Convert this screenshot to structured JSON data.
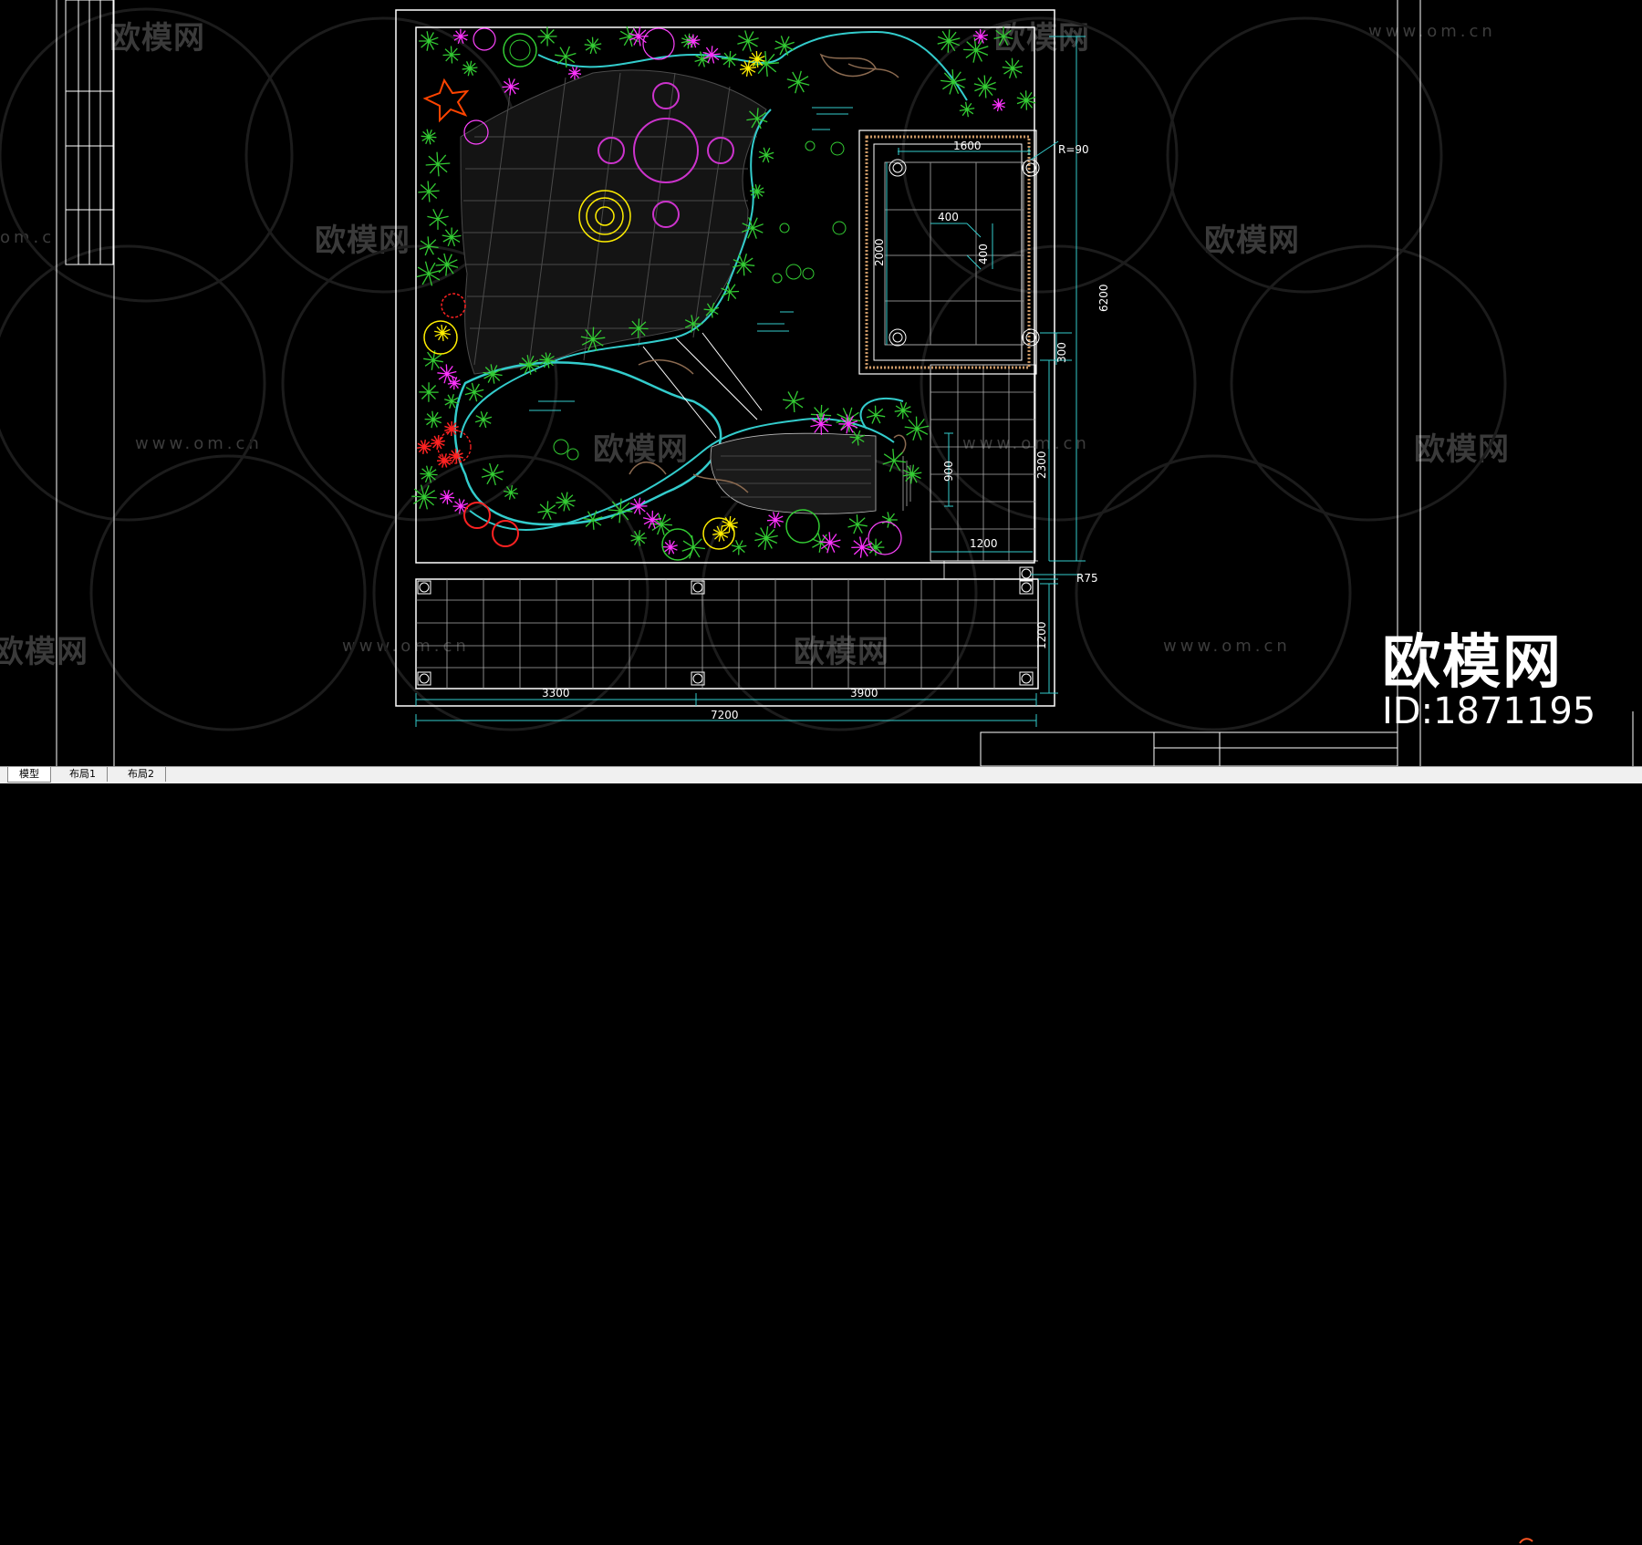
{
  "watermark": {
    "brand": "欧模网",
    "url": "www.om.cn",
    "url_fragment": "om.c"
  },
  "brand_overlay": {
    "name": "欧模网",
    "id_text": "ID:1871195"
  },
  "dimensions": {
    "d1600": "1600",
    "r90": "R=90",
    "d400a": "400",
    "d400b": "400",
    "d2000": "2000",
    "d6200": "6200",
    "d300": "300",
    "d900": "900",
    "d2300": "2300",
    "d1200h": "1200",
    "r75": "R75",
    "d1200v": "1200",
    "d3300": "3300",
    "d3900": "3900",
    "d7200": "7200"
  },
  "tabs": [
    {
      "label": "模型",
      "active": true
    },
    {
      "label": "布局1",
      "active": false
    },
    {
      "label": "布局2",
      "active": false
    }
  ],
  "colors": {
    "background": "#000000",
    "plant_green": "#33cc33",
    "plant_magenta": "#ff33ff",
    "plant_red": "#ff2222",
    "plant_yellow": "#ffee00",
    "water_cyan": "#33cccc",
    "stone_brown": "#8b6a50"
  }
}
